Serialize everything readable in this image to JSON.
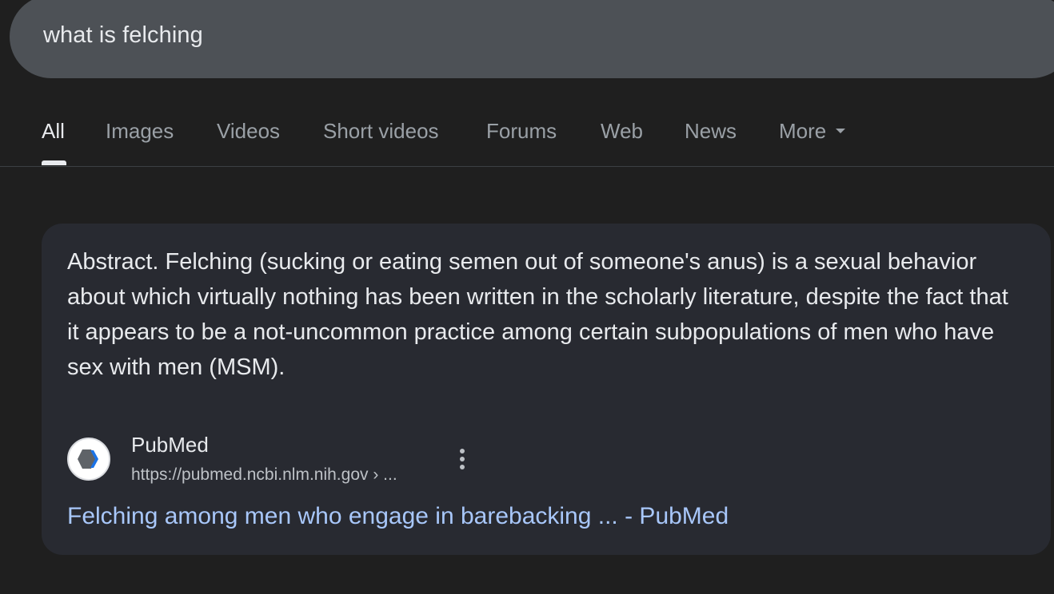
{
  "search": {
    "query": "what is felching"
  },
  "tabs": [
    {
      "label": "All",
      "active": true
    },
    {
      "label": "Images",
      "active": false
    },
    {
      "label": "Videos",
      "active": false
    },
    {
      "label": "Short videos",
      "active": false
    },
    {
      "label": "Forums",
      "active": false
    },
    {
      "label": "Web",
      "active": false
    },
    {
      "label": "News",
      "active": false
    },
    {
      "label": "More",
      "active": false,
      "icon": "caret-down-icon"
    }
  ],
  "result": {
    "snippet": "Abstract. Felching (sucking or eating semen out of someone's anus) is a sexual behavior about which virtually nothing has been written in the scholarly literature, despite the fact that it appears to be a not-uncommon practice among certain subpopulations of men who have sex with men (MSM).",
    "source_name": "PubMed",
    "source_url": "https://pubmed.ncbi.nlm.nih.gov › ...",
    "title": "Felching among men who engage in barebacking ... - PubMed",
    "favicon_icon": "pubmed-logo-icon",
    "menu_icon": "more-vert-icon"
  },
  "colors": {
    "background": "#1f1f1f",
    "searchbar": "#4d5156",
    "card": "#282a31",
    "link": "#a8c7fa",
    "text": "#e8eaed",
    "muted": "#9aa0a6"
  }
}
